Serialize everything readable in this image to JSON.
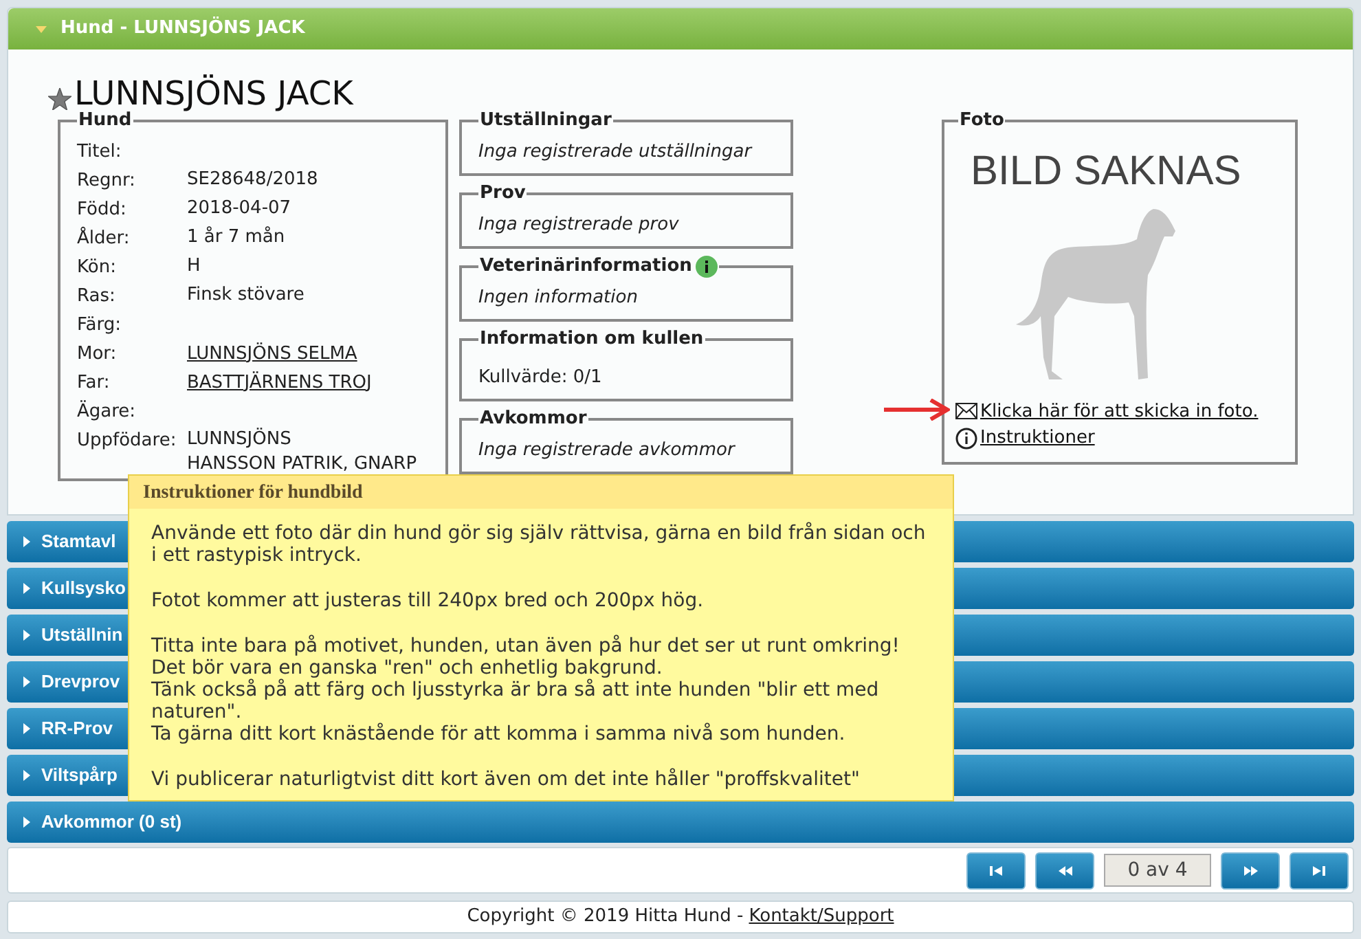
{
  "header": {
    "title": "Hund - LUNNSJÖNS JACK",
    "expanded": true
  },
  "dog_name": "LUNNSJÖNS JACK",
  "hund": {
    "legend": "Hund",
    "rows": [
      {
        "label": "Titel:"
      },
      {
        "label": "Regnr:",
        "lines": [
          "SE28648/2018"
        ],
        "kind": "text"
      },
      {
        "label": "Född:",
        "lines": [
          "2018-04-07"
        ],
        "kind": "text"
      },
      {
        "label": "Ålder:",
        "lines": [
          "1 år 7 mån"
        ],
        "kind": "text"
      },
      {
        "label": "Kön:",
        "lines": [
          "H"
        ],
        "kind": "text"
      },
      {
        "label": "Ras:",
        "lines": [
          "Finsk stövare"
        ],
        "kind": "text"
      },
      {
        "label": "Färg:"
      },
      {
        "label": "Mor:",
        "lines": [
          "LUNNSJÖNS SELMA"
        ],
        "kind": "link"
      },
      {
        "label": "Far:",
        "lines": [
          "BASTTJÄRNENS TROJ"
        ],
        "kind": "link"
      },
      {
        "label": "Ägare:"
      },
      {
        "label": "Uppfödare:",
        "lines": [
          "LUNNSJÖNS",
          "HANSSON PATRIK, GNARP"
        ],
        "kind": "text"
      }
    ]
  },
  "boxes": [
    {
      "legend": "Utställningar",
      "text": "Inga registrerade utställningar",
      "kind": "italic",
      "info": false
    },
    {
      "legend": "Prov",
      "text": "Inga registrerade prov",
      "kind": "italic",
      "info": false
    },
    {
      "legend": "Veterinärinformation",
      "text": "Ingen information",
      "kind": "italic",
      "info": true
    },
    {
      "legend": "Information om kullen",
      "text": "Kullvärde: 0/1",
      "kind": "plain",
      "info": false
    },
    {
      "legend": "Avkommor",
      "text": "Inga registrerade avkommor",
      "kind": "italic",
      "info": false
    }
  ],
  "foto": {
    "legend": "Foto",
    "missing_text": "BILD SAKNAS",
    "send_link": "Klicka här för att skicka in foto.",
    "instructions_link": "Instruktioner"
  },
  "sections": [
    {
      "label": "Stamtavl",
      "expanded": false
    },
    {
      "label": "Kullsysko",
      "expanded": false
    },
    {
      "label": "Utställnin",
      "expanded": false
    },
    {
      "label": "Drevprov",
      "expanded": false
    },
    {
      "label": "RR-Prov",
      "expanded": false
    },
    {
      "label": "Viltspårp",
      "expanded": false
    },
    {
      "label": "Avkommor (0 st)",
      "expanded": false
    }
  ],
  "tooltip": {
    "title": "Instruktioner för hundbild",
    "paragraphs": [
      [
        "Använde ett foto där din hund gör sig själv rättvisa, gärna en bild från sidan och i ett rastypisk intryck."
      ],
      [
        "Fotot kommer att justeras till 240px bred och 200px hög."
      ],
      [
        "Titta inte bara på motivet, hunden, utan även på hur det ser ut runt omkring!",
        "Det bör vara en ganska \"ren\" och enhetlig bakgrund.",
        "Tänk också på att färg och ljusstyrka är bra så att inte hunden \"blir ett med naturen\".",
        "Ta gärna ditt kort knästående för att komma i samma nivå som hunden."
      ],
      [
        "Vi publicerar naturligtvist ditt kort även om det inte håller \"proffskvalitet\""
      ]
    ]
  },
  "pager": {
    "counter": "0 av 4"
  },
  "footer": {
    "text": "Copyright © 2019 Hitta Hund -",
    "link": "Kontakt/Support"
  }
}
